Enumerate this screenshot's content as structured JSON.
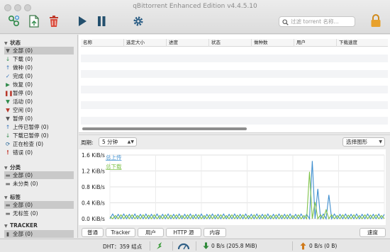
{
  "window": {
    "title": "qBittorrent Enhanced Edition v4.4.5.10"
  },
  "toolbar": {
    "add_torrent_link_icon": "link-add-icon",
    "add_torrent_file_icon": "file-add-icon",
    "delete_icon": "trash-icon",
    "resume_icon": "play-icon",
    "pause_icon": "pause-icon",
    "options_icon": "gear-icon",
    "search_placeholder": "过滤 torrent 名称...",
    "lock_icon": "lock-icon"
  },
  "sidebar": {
    "status_header": "状态",
    "status_items": [
      {
        "label": "全部 (0)",
        "icon": "filter-icon",
        "selected": true
      },
      {
        "label": "下载 (0)",
        "icon": "download-arrow-icon"
      },
      {
        "label": "做种 (0)",
        "icon": "upload-arrow-icon"
      },
      {
        "label": "完成 (0)",
        "icon": "check-icon"
      },
      {
        "label": "恢复 (0)",
        "icon": "play-icon"
      },
      {
        "label": "暂停 (0)",
        "icon": "pause-icon"
      },
      {
        "label": "活动 (0)",
        "icon": "filter-icon"
      },
      {
        "label": "空闲 (0)",
        "icon": "filter-icon"
      },
      {
        "label": "暂停 (0)",
        "icon": "filter-icon"
      },
      {
        "label": "上传已暂停 (0)",
        "icon": "upload-arrow-icon"
      },
      {
        "label": "下载已暂停 (0)",
        "icon": "download-arrow-icon"
      },
      {
        "label": "正在检查 (0)",
        "icon": "checking-icon"
      },
      {
        "label": "错误 (0)",
        "icon": "error-icon"
      }
    ],
    "category_header": "分类",
    "category_items": [
      {
        "label": "全部 (0)",
        "icon": "folder-icon",
        "selected": true
      },
      {
        "label": "未分类 (0)",
        "icon": "folder-icon"
      }
    ],
    "tags_header": "标签",
    "tag_items": [
      {
        "label": "全部 (0)",
        "icon": "folder-icon",
        "selected": true
      },
      {
        "label": "无标签 (0)",
        "icon": "folder-icon"
      }
    ],
    "tracker_header": "TRACKER",
    "tracker_items": [
      {
        "label": "全部 (0)",
        "icon": "tracker-icon",
        "selected": true
      }
    ]
  },
  "table": {
    "columns": [
      "名称",
      "选定大小",
      "进度",
      "状态",
      "做种数",
      "用户",
      "下载速度"
    ]
  },
  "graph": {
    "period_label": "周期:",
    "period_value": "5 分钟",
    "select_graph_label": "选择图形",
    "tabs": [
      "普通",
      "Tracker",
      "用户",
      "HTTP 源",
      "内容"
    ],
    "speed_tab": "速度"
  },
  "statusbar": {
    "dht": "DHT：359 结点",
    "download": "0 B/s (205.8 MiB)",
    "upload": "0 B/s (0 B)"
  },
  "chart_data": {
    "type": "line",
    "ylabel": "",
    "y_ticks": [
      "0.0 KiB/s",
      "0.4 KiB/s",
      "0.8 KiB/s",
      "1.2 KiB/s",
      "1.6 KiB/s"
    ],
    "ylim": [
      0,
      1.6
    ],
    "x": [
      0,
      1,
      2,
      3,
      4,
      5,
      6,
      7,
      8,
      9,
      10,
      11,
      12,
      13,
      14,
      15,
      16,
      17,
      18,
      19,
      20,
      21,
      22,
      23,
      24,
      25,
      26,
      27,
      28,
      29,
      30,
      31,
      32,
      33,
      34,
      35,
      36,
      37,
      38,
      39,
      40,
      41,
      42,
      43,
      44,
      45,
      46,
      47,
      48,
      49,
      50,
      51,
      52,
      53,
      54,
      55,
      56,
      57,
      58,
      59,
      60,
      61,
      62,
      63,
      64,
      65,
      66,
      67,
      68,
      69,
      70,
      71,
      72,
      73,
      74,
      75,
      76,
      77,
      78,
      79,
      80,
      81,
      82,
      83,
      84,
      85,
      86,
      87,
      88,
      89,
      90,
      91,
      92,
      93,
      94,
      95,
      96,
      97,
      98,
      99
    ],
    "series": [
      {
        "name": "总上传",
        "color": "#3f8fcf",
        "values": [
          0.0,
          0.12,
          0.0,
          0.11,
          0.0,
          0.12,
          0.0,
          0.11,
          0.0,
          0.12,
          0.0,
          0.11,
          0.0,
          0.12,
          0.0,
          0.11,
          0.0,
          0.12,
          0.0,
          0.11,
          0.0,
          0.12,
          0.0,
          0.11,
          0.0,
          0.12,
          0.0,
          0.11,
          0.0,
          0.12,
          0.0,
          0.11,
          0.0,
          0.12,
          0.0,
          0.11,
          0.0,
          0.12,
          0.0,
          0.11,
          0.0,
          0.12,
          0.0,
          0.11,
          0.0,
          0.12,
          0.0,
          0.11,
          0.0,
          0.12,
          0.0,
          0.11,
          0.0,
          0.12,
          0.0,
          0.11,
          0.0,
          0.12,
          0.0,
          0.11,
          0.0,
          0.12,
          0.0,
          0.11,
          0.0,
          0.12,
          0.0,
          0.11,
          0.0,
          0.12,
          0.0,
          0.11,
          0.0,
          1.45,
          0.0,
          0.75,
          0.0,
          0.12,
          0.0,
          0.6,
          0.0,
          0.12,
          0.0,
          0.11,
          0.0,
          0.12,
          0.0,
          0.11,
          0.0,
          0.12,
          0.0,
          0.11,
          0.0,
          0.12,
          0.0,
          0.11,
          0.0,
          0.12,
          0.0,
          0.11
        ]
      },
      {
        "name": "总下载",
        "color": "#7fc24a",
        "values": [
          0.05,
          0.0,
          0.08,
          0.0,
          0.1,
          0.0,
          0.09,
          0.0,
          0.1,
          0.0,
          0.08,
          0.0,
          0.1,
          0.0,
          0.09,
          0.0,
          0.1,
          0.0,
          0.08,
          0.0,
          0.1,
          0.0,
          0.09,
          0.0,
          0.1,
          0.0,
          0.08,
          0.0,
          0.1,
          0.0,
          0.09,
          0.0,
          0.1,
          0.0,
          0.08,
          0.0,
          0.1,
          0.0,
          0.09,
          0.0,
          0.1,
          0.0,
          0.08,
          0.0,
          0.1,
          0.0,
          0.09,
          0.0,
          0.1,
          0.0,
          0.08,
          0.0,
          0.1,
          0.0,
          0.09,
          0.0,
          0.1,
          0.0,
          0.08,
          0.0,
          0.1,
          0.0,
          0.09,
          0.0,
          0.1,
          0.0,
          0.08,
          0.0,
          0.1,
          0.0,
          0.08,
          0.0,
          1.18,
          0.0,
          0.42,
          0.0,
          0.1,
          0.0,
          0.22,
          0.0,
          0.1,
          0.0,
          0.08,
          0.0,
          0.1,
          0.0,
          0.09,
          0.0,
          0.1,
          0.0,
          0.08,
          0.0,
          0.1,
          0.0,
          0.09,
          0.0,
          0.1,
          0.0,
          0.08,
          0.0
        ]
      }
    ],
    "grid": true,
    "legend": "top-left"
  }
}
